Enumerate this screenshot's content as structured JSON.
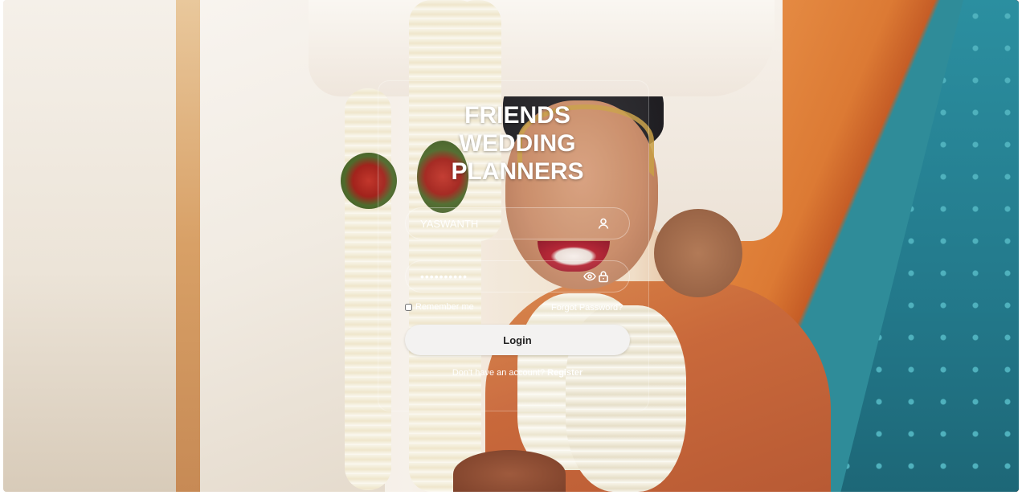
{
  "brand": {
    "title_lines": [
      "FRIENDS",
      "WEDDING",
      "PLANNERS"
    ]
  },
  "login_form": {
    "username_value": "YASWANTH",
    "password_value": "••••••••••",
    "remember_label": "Remember me",
    "forgot_label": "Forgot Password?",
    "login_label": "Login",
    "register_prompt": "Don't have an account?",
    "register_label": "Register"
  },
  "icons": {
    "username": "user-icon",
    "password_visibility": "eye-icon",
    "password": "lock-icon"
  },
  "colors": {
    "text_on_image": "#ffffff",
    "button_bg": "#f3f2f1",
    "button_text": "#222222"
  }
}
